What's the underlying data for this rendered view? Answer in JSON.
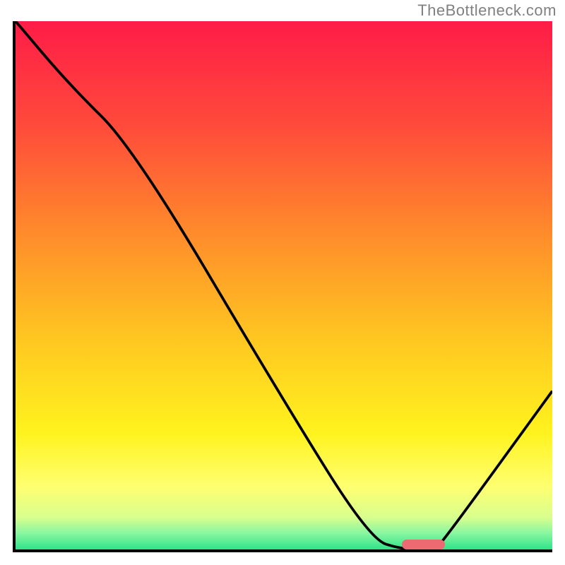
{
  "watermark": "TheBottleneck.com",
  "colors": {
    "border": "#000000",
    "watermark": "#808080",
    "marker": "#ed6a72",
    "curve": "#000000"
  },
  "chart_data": {
    "type": "line",
    "title": "",
    "xlabel": "",
    "ylabel": "",
    "xlim": [
      0,
      100
    ],
    "ylim": [
      0,
      100
    ],
    "background_gradient_stops": [
      {
        "pos": 0.0,
        "color": "#ff1c47"
      },
      {
        "pos": 0.2,
        "color": "#ff4b3b"
      },
      {
        "pos": 0.4,
        "color": "#ff8b2b"
      },
      {
        "pos": 0.6,
        "color": "#ffc621"
      },
      {
        "pos": 0.78,
        "color": "#fff31e"
      },
      {
        "pos": 0.88,
        "color": "#ffff70"
      },
      {
        "pos": 0.94,
        "color": "#d8ff8e"
      },
      {
        "pos": 0.97,
        "color": "#86f6a0"
      },
      {
        "pos": 1.0,
        "color": "#2fe38a"
      }
    ],
    "series": [
      {
        "name": "bottleneck-curve",
        "x": [
          0,
          10,
          22,
          50,
          66,
          72,
          78,
          80,
          100
        ],
        "y": [
          100,
          88,
          76,
          28,
          2,
          0,
          0,
          2,
          30
        ]
      }
    ],
    "markers": [
      {
        "name": "optimal-zone",
        "x_start": 72,
        "x_end": 80,
        "y": 1,
        "color": "#ed6a72"
      }
    ]
  }
}
